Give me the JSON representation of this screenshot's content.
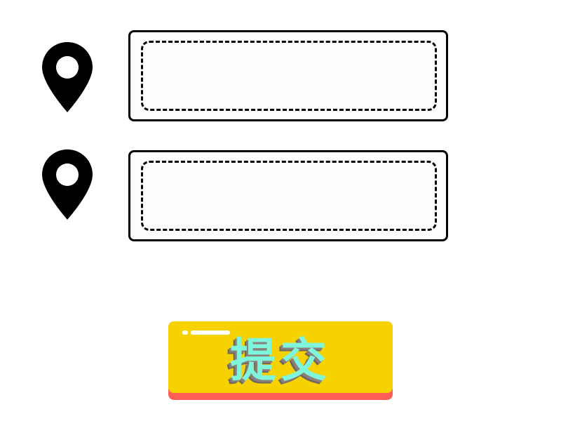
{
  "form": {
    "fields": [
      {
        "icon": "location-pin-icon",
        "value": "",
        "placeholder": ""
      },
      {
        "icon": "location-pin-icon",
        "value": "",
        "placeholder": ""
      }
    ],
    "submit": {
      "label": "提交"
    }
  },
  "colors": {
    "button_face": "#f6d200",
    "button_shadow": "#ff5e57",
    "button_text": "#7ff5dc",
    "outline": "#000000"
  }
}
